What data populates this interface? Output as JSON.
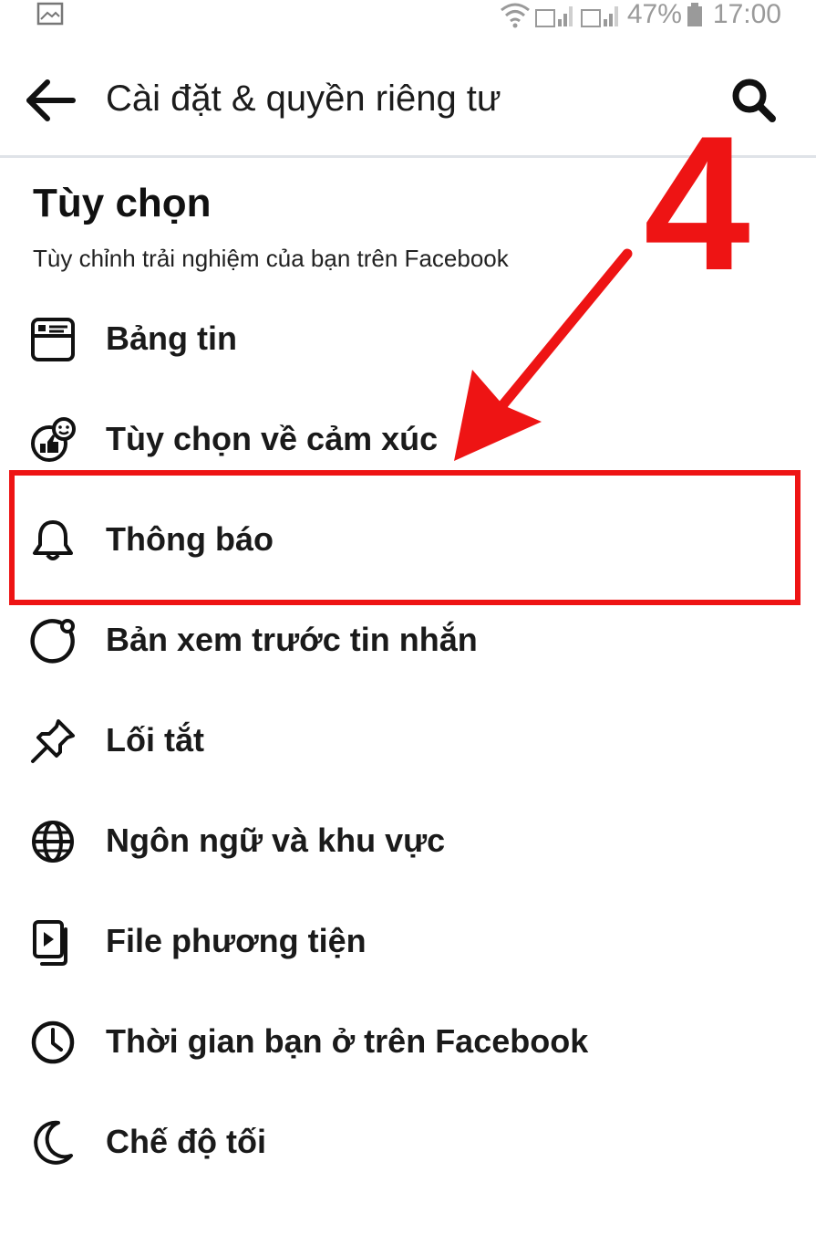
{
  "status_bar": {
    "battery_percent": "47%",
    "time": "17:00",
    "icons": [
      "gallery-icon",
      "wifi-icon",
      "signal-icon",
      "signal-icon",
      "battery-icon"
    ]
  },
  "header": {
    "title": "Cài đặt & quyền riêng tư",
    "back_icon": "arrow-left-icon",
    "search_icon": "search-icon"
  },
  "section": {
    "title": "Tùy chọn",
    "subtitle": "Tùy chỉnh trải nghiệm của bạn trên Facebook"
  },
  "menu": {
    "items": [
      {
        "label": "Bảng tin",
        "icon": "news-feed-icon"
      },
      {
        "label": "Tùy chọn về cảm xúc",
        "icon": "reactions-icon"
      },
      {
        "label": "Thông báo",
        "icon": "bell-icon",
        "highlighted": true
      },
      {
        "label": "Bản xem trước tin nhắn",
        "icon": "message-preview-icon"
      },
      {
        "label": "Lối tắt",
        "icon": "pin-icon"
      },
      {
        "label": "Ngôn ngữ và khu vực",
        "icon": "globe-icon"
      },
      {
        "label": "File phương tiện",
        "icon": "media-file-icon"
      },
      {
        "label": "Thời gian bạn ở trên Facebook",
        "icon": "clock-icon"
      },
      {
        "label": "Chế độ tối",
        "icon": "moon-icon"
      }
    ]
  },
  "annotation": {
    "step_number": "4",
    "color": "#ee1414"
  }
}
